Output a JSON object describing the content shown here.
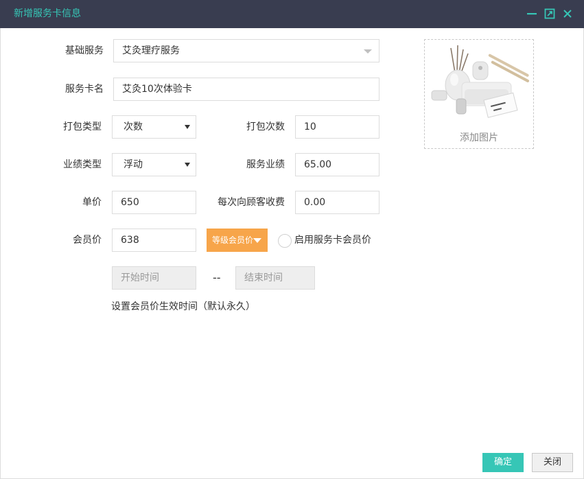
{
  "window": {
    "title": "新增服务卡信息",
    "accent_color": "#36c6b6",
    "titlebar_color": "#393d50",
    "controls": [
      "minimize-icon",
      "maximize-icon",
      "close-icon"
    ]
  },
  "form": {
    "base_service": {
      "label": "基础服务",
      "value": "艾灸理疗服务"
    },
    "card_name": {
      "label": "服务卡名",
      "value": "艾灸10次体验卡"
    },
    "package_type": {
      "label": "打包类型",
      "value": "次数"
    },
    "package_count": {
      "label": "打包次数",
      "value": "10"
    },
    "performance_type": {
      "label": "业绩类型",
      "value": "浮动"
    },
    "service_performance": {
      "label": "服务业绩",
      "value": "65.00"
    },
    "unit_price": {
      "label": "单价",
      "value": "650"
    },
    "customer_fee": {
      "label": "每次向顾客收费",
      "value": "0.00"
    },
    "member_price": {
      "label": "会员价",
      "value": "638"
    },
    "level_price_button": {
      "label": "等级会员价",
      "color": "#f7a54a"
    },
    "enable_card_member_price": {
      "label": "启用服务卡会员价",
      "checked": false
    },
    "start_time": {
      "placeholder": "开始时间"
    },
    "range_separator": "--",
    "end_time": {
      "placeholder": "结束时间"
    },
    "time_hint": "设置会员价生效时间（默认永久）"
  },
  "image_upload": {
    "caption": "添加图片"
  },
  "footer": {
    "confirm_label": "确定",
    "close_label": "关闭"
  }
}
